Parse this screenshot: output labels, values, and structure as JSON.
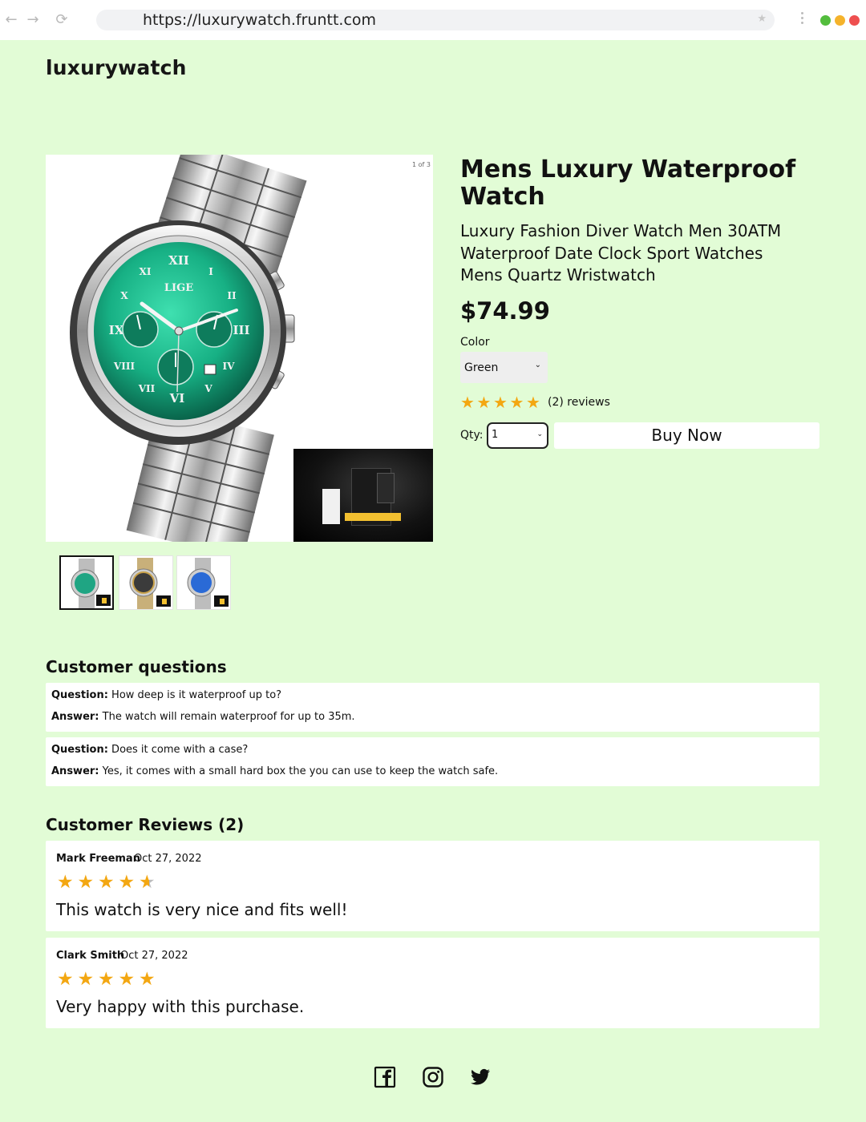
{
  "browser": {
    "url": "https://luxurywatch.fruntt.com",
    "icons": [
      "back-arrow-icon",
      "forward-arrow-icon",
      "reload-icon",
      "bookmark-star-icon",
      "kebab-menu-icon"
    ],
    "window_dot_colors": [
      "#53bd3d",
      "#f5b32b",
      "#ee4f4f"
    ]
  },
  "store": {
    "name": "luxurywatch"
  },
  "gallery": {
    "counter": "1 of 3",
    "brand_on_dial": "LIGE",
    "accent_dial_color": "#1fb58a",
    "thumbnails": [
      {
        "dial_color": "#1fa583",
        "active": true
      },
      {
        "dial_color": "#c9a24a",
        "active": false
      },
      {
        "dial_color": "#2a6ad6",
        "active": false
      }
    ]
  },
  "product": {
    "title": "Mens Luxury Waterproof Watch",
    "subtitle": "Luxury Fashion Diver Watch Men 30ATM Waterproof Date Clock Sport Watches Mens Quartz Wristwatch",
    "price": "$74.99",
    "color_label": "Color",
    "color_selected": "Green",
    "rating": 5,
    "reviews_label": "(2) reviews",
    "qty_label": "Qty:",
    "qty_selected": "1",
    "buy_label": "Buy Now",
    "star_color": "#f3a712"
  },
  "questions": {
    "heading": "Customer questions",
    "question_prefix": "Question:",
    "answer_prefix": "Answer:",
    "items": [
      {
        "question": " How deep is it waterproof up to?",
        "answer": " The watch will remain waterproof for up to 35m."
      },
      {
        "question": " Does it come with a case?",
        "answer": " Yes, it comes with a small hard box the you can use to keep the watch safe."
      }
    ]
  },
  "reviews": {
    "heading": "Customer Reviews (2)",
    "items": [
      {
        "name": "Mark Freeman",
        "date": "Oct 27, 2022",
        "rating": 4.5,
        "text": "This watch is very nice and fits well!"
      },
      {
        "name": "Clark Smith",
        "date": "Oct 27, 2022",
        "rating": 5,
        "text": "Very happy with this purchase."
      }
    ]
  },
  "footer": {
    "social_icons": [
      "facebook-icon",
      "instagram-icon",
      "twitter-icon"
    ]
  }
}
